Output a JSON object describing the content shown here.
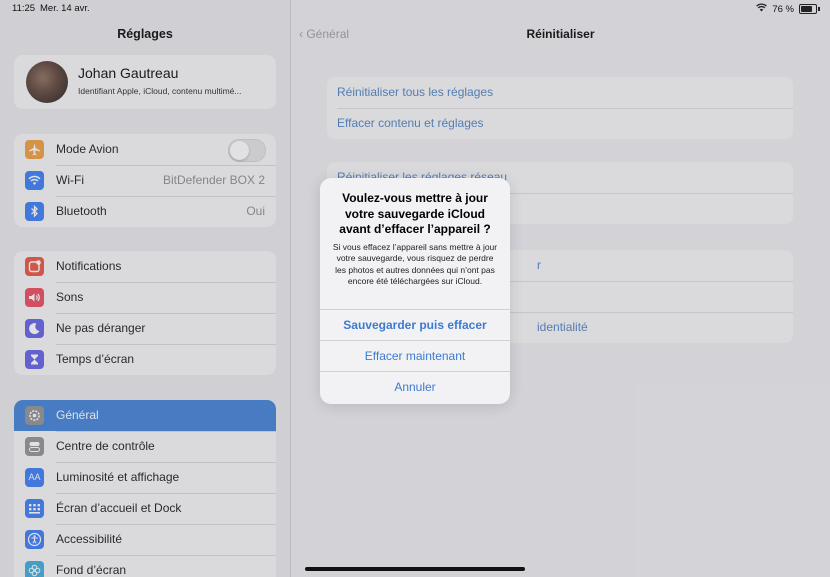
{
  "status": {
    "time": "11:25",
    "date": "Mer. 14 avr.",
    "battery": "76 %"
  },
  "sidebar": {
    "title": "Réglages",
    "profile": {
      "name": "Johan Gautreau",
      "subtitle": "Identifiant Apple, iCloud, contenu multimé..."
    },
    "group1": [
      {
        "label": "Mode Avion",
        "toggle": false,
        "icon": "airplane-icon",
        "color": "#f19a37"
      },
      {
        "label": "Wi-Fi",
        "value": "BitDefender BOX 2",
        "icon": "wifi-icon",
        "color": "#3478f6"
      },
      {
        "label": "Bluetooth",
        "value": "Oui",
        "icon": "bluetooth-icon",
        "color": "#3478f6"
      }
    ],
    "group2": [
      {
        "label": "Notifications",
        "icon": "notifications-icon",
        "color": "#eb4d3d"
      },
      {
        "label": "Sons",
        "icon": "speaker-icon",
        "color": "#eb445a"
      },
      {
        "label": "Ne pas déranger",
        "icon": "moon-icon",
        "color": "#5e5ce6"
      },
      {
        "label": "Temps d’écran",
        "icon": "hourglass-icon",
        "color": "#5e5ce6"
      }
    ],
    "group3": [
      {
        "label": "Général",
        "icon": "gear-icon",
        "color": "#8e8e93",
        "selected": true
      },
      {
        "label": "Centre de contrôle",
        "icon": "toggles-icon",
        "color": "#8e8e93"
      },
      {
        "label": "Luminosité et affichage",
        "icon": "text-size-icon",
        "color": "#3478f6"
      },
      {
        "label": "Écran d’accueil et Dock",
        "icon": "grid-icon",
        "color": "#3478f6"
      },
      {
        "label": "Accessibilité",
        "icon": "accessibility-icon",
        "color": "#3478f6"
      },
      {
        "label": "Fond d’écran",
        "icon": "flower-icon",
        "color": "#36aadc"
      }
    ]
  },
  "detail": {
    "back_label": "Général",
    "title": "Réinitialiser",
    "group1": [
      {
        "label": "Réinitialiser tous les réglages"
      },
      {
        "label": "Effacer contenu et réglages"
      }
    ],
    "group2": [
      {
        "label": "Réinitialiser les réglages réseau"
      },
      {
        "label": ""
      }
    ],
    "group3": [
      {
        "label": "",
        "tail": "r"
      },
      {
        "label": ""
      },
      {
        "label": "",
        "tail": "identialité"
      }
    ]
  },
  "alert": {
    "title": "Voulez-vous mettre à jour votre sauvegarde iCloud avant d’effacer l’appareil ?",
    "message": "Si vous effacez l’appareil sans mettre à jour votre sauvegarde, vous risquez de perdre les photos et autres données qui n’ont pas encore été téléchargées sur iCloud.",
    "buttons": [
      "Sauvegarder puis effacer",
      "Effacer maintenant",
      "Annuler"
    ]
  }
}
